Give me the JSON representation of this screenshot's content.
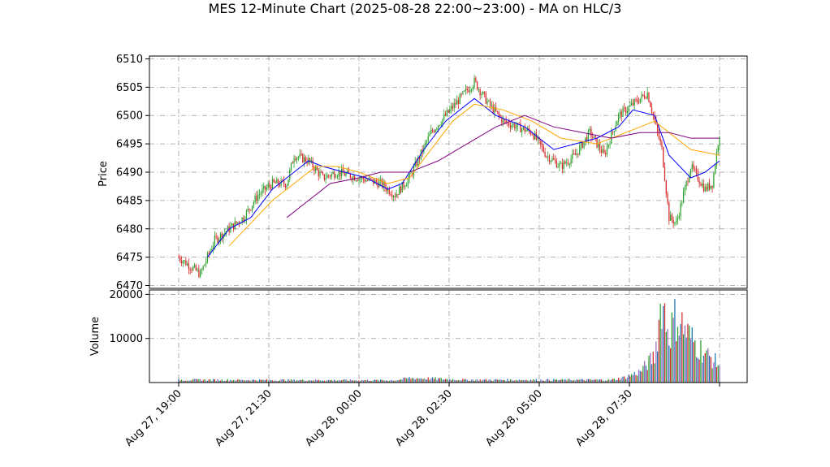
{
  "chart_data": {
    "type": "candlestick",
    "title": "MES 12-Minute Chart (2025-08-28 22:00~23:00) - MA on HLC/3",
    "price_panel": {
      "ylabel": "Price",
      "ylim": [
        6469.5,
        6510.5
      ],
      "yticks": [
        "6470",
        "6475",
        "6480",
        "6485",
        "6490",
        "6495",
        "6500",
        "6505",
        "6510"
      ],
      "grid": true
    },
    "volume_panel": {
      "ylabel": "Volume",
      "ylim": [
        0,
        20000
      ],
      "yticks": [
        "10000",
        "20000"
      ],
      "grid": true
    },
    "x": {
      "tick_labels": [
        "Aug 27, 19:00",
        "Aug 27, 21:30",
        "Aug 28, 00:00",
        "Aug 28, 02:30",
        "Aug 28, 05:00",
        "Aug 28, 07:30"
      ],
      "tick_bar_index": [
        0,
        12.5,
        25,
        37.5,
        50,
        62.5
      ],
      "bar_count": 76
    },
    "colors": {
      "up": "#2ca02c",
      "down": "#d62728",
      "ma_fast": "#0000ff",
      "ma_mid": "#ffa500",
      "ma_slow": "#800080",
      "volume": [
        "#1f77b4",
        "#d62728",
        "#2ca02c",
        "#9467bd"
      ]
    },
    "price_path": [
      [
        0,
        6475
      ],
      [
        3,
        6472
      ],
      [
        5,
        6478
      ],
      [
        7,
        6480
      ],
      [
        9,
        6482
      ],
      [
        11,
        6486
      ],
      [
        13,
        6488
      ],
      [
        15,
        6488
      ],
      [
        16,
        6493
      ],
      [
        18,
        6492
      ],
      [
        20,
        6489
      ],
      [
        22,
        6490
      ],
      [
        25,
        6489
      ],
      [
        28,
        6488
      ],
      [
        30,
        6486
      ],
      [
        32,
        6489
      ],
      [
        35,
        6497
      ],
      [
        37,
        6500
      ],
      [
        39,
        6503
      ],
      [
        41,
        6506
      ],
      [
        43,
        6502
      ],
      [
        45,
        6499
      ],
      [
        47,
        6498
      ],
      [
        49,
        6497
      ],
      [
        51,
        6493
      ],
      [
        53,
        6491
      ],
      [
        55,
        6493
      ],
      [
        57,
        6497
      ],
      [
        59,
        6493
      ],
      [
        61,
        6500
      ],
      [
        63,
        6502
      ],
      [
        65,
        6504
      ],
      [
        67,
        6494
      ],
      [
        68,
        6482
      ],
      [
        69,
        6481
      ],
      [
        71,
        6491
      ],
      [
        73,
        6487
      ],
      [
        74,
        6488
      ],
      [
        75,
        6497
      ]
    ],
    "volume_path": [
      [
        0,
        600
      ],
      [
        30,
        500
      ],
      [
        32,
        1000
      ],
      [
        35,
        900
      ],
      [
        40,
        600
      ],
      [
        60,
        600
      ],
      [
        62,
        1200
      ],
      [
        64,
        2500
      ],
      [
        66,
        6000
      ],
      [
        67,
        19000
      ],
      [
        68,
        11000
      ],
      [
        69,
        15000
      ],
      [
        71,
        10000
      ],
      [
        73,
        6500
      ],
      [
        75,
        4000
      ]
    ],
    "ma_fast": [
      [
        4,
        6475
      ],
      [
        7,
        6480
      ],
      [
        10,
        6482
      ],
      [
        13,
        6487
      ],
      [
        16,
        6490
      ],
      [
        18,
        6492
      ],
      [
        20,
        6491
      ],
      [
        23,
        6490
      ],
      [
        26,
        6489
      ],
      [
        29,
        6487
      ],
      [
        31,
        6488
      ],
      [
        34,
        6494
      ],
      [
        37,
        6499
      ],
      [
        41,
        6503
      ],
      [
        44,
        6500
      ],
      [
        48,
        6498
      ],
      [
        52,
        6494
      ],
      [
        55,
        6495
      ],
      [
        58,
        6496
      ],
      [
        61,
        6498
      ],
      [
        63,
        6501
      ],
      [
        66,
        6500
      ],
      [
        68,
        6493
      ],
      [
        71,
        6489
      ],
      [
        73,
        6490
      ],
      [
        75,
        6492
      ]
    ],
    "ma_mid": [
      [
        7,
        6477
      ],
      [
        10,
        6481
      ],
      [
        13,
        6485
      ],
      [
        16,
        6488
      ],
      [
        19,
        6491
      ],
      [
        22,
        6491
      ],
      [
        25,
        6490
      ],
      [
        29,
        6488
      ],
      [
        32,
        6489
      ],
      [
        35,
        6494
      ],
      [
        38,
        6499
      ],
      [
        41,
        6502
      ],
      [
        45,
        6501
      ],
      [
        49,
        6499
      ],
      [
        53,
        6496
      ],
      [
        58,
        6495
      ],
      [
        62,
        6497
      ],
      [
        66,
        6499
      ],
      [
        68,
        6497
      ],
      [
        71,
        6494
      ],
      [
        75,
        6493
      ]
    ],
    "ma_slow": [
      [
        15,
        6482
      ],
      [
        18,
        6485
      ],
      [
        21,
        6488
      ],
      [
        25,
        6489
      ],
      [
        28,
        6490
      ],
      [
        32,
        6490
      ],
      [
        36,
        6492
      ],
      [
        40,
        6495
      ],
      [
        44,
        6498
      ],
      [
        48,
        6500
      ],
      [
        52,
        6498
      ],
      [
        56,
        6497
      ],
      [
        60,
        6496
      ],
      [
        64,
        6497
      ],
      [
        68,
        6497
      ],
      [
        71,
        6496
      ],
      [
        75,
        6496
      ]
    ]
  }
}
